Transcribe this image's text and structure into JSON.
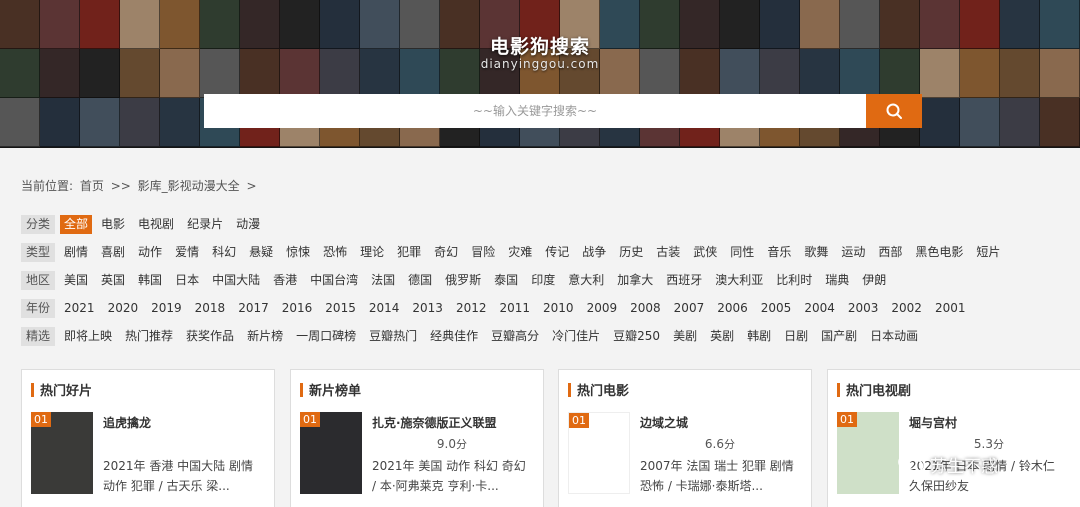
{
  "header": {
    "title": "电影狗搜索",
    "domain": "dianyinggou.com",
    "search_placeholder": "~~输入关键字搜索~~"
  },
  "breadcrumb": {
    "label": "当前位置:",
    "home": "首页",
    "sep": ">>",
    "current": "影库_影视动漫大全",
    "trail": ">"
  },
  "filters": [
    {
      "label": "分类",
      "items": [
        "全部",
        "电影",
        "电视剧",
        "纪录片",
        "动漫"
      ],
      "active": 0
    },
    {
      "label": "类型",
      "items": [
        "剧情",
        "喜剧",
        "动作",
        "爱情",
        "科幻",
        "悬疑",
        "惊悚",
        "恐怖",
        "理论",
        "犯罪",
        "奇幻",
        "冒险",
        "灾难",
        "传记",
        "战争",
        "历史",
        "古装",
        "武侠",
        "同性",
        "音乐",
        "歌舞",
        "运动",
        "西部",
        "黑色电影",
        "短片"
      ],
      "active": -1
    },
    {
      "label": "地区",
      "items": [
        "美国",
        "英国",
        "韩国",
        "日本",
        "中国大陆",
        "香港",
        "中国台湾",
        "法国",
        "德国",
        "俄罗斯",
        "泰国",
        "印度",
        "意大利",
        "加拿大",
        "西班牙",
        "澳大利亚",
        "比利时",
        "瑞典",
        "伊朗"
      ],
      "active": -1
    },
    {
      "label": "年份",
      "items": [
        "2021",
        "2020",
        "2019",
        "2018",
        "2017",
        "2016",
        "2015",
        "2014",
        "2013",
        "2012",
        "2011",
        "2010",
        "2009",
        "2008",
        "2007",
        "2006",
        "2005",
        "2004",
        "2003",
        "2002",
        "2001"
      ],
      "active": -1
    },
    {
      "label": "精选",
      "items": [
        "即将上映",
        "热门推荐",
        "获奖作品",
        "新片榜",
        "一周口碑榜",
        "豆瓣热门",
        "经典佳作",
        "豆瓣高分",
        "冷门佳片",
        "豆瓣250",
        "美剧",
        "英剧",
        "韩剧",
        "日剧",
        "国产剧",
        "日本动画"
      ],
      "active": -1
    }
  ],
  "cards": [
    {
      "heading": "热门好片",
      "rank": "01",
      "title": "追虎擒龙",
      "score": "",
      "unit": "",
      "meta": "2021年 香港 中国大陆 剧情 动作 犯罪 / 古天乐 梁...",
      "thumb_color": "#3a3a38"
    },
    {
      "heading": "新片榜单",
      "rank": "01",
      "title": "扎克·施奈德版正义联盟",
      "score": "9.0",
      "unit": "分",
      "meta": "2021年 美国 动作 科幻 奇幻 / 本·阿弗莱克 亨利·卡...",
      "thumb_color": "#2b2b2e"
    },
    {
      "heading": "热门电影",
      "rank": "01",
      "title": "边域之城",
      "score": "6.6",
      "unit": "分",
      "meta": "2007年 法国 瑞士 犯罪 剧情 恐怖 / 卡瑞娜·泰斯塔...",
      "thumb_color": ""
    },
    {
      "heading": "热门电视剧",
      "rank": "01",
      "title": "堀与宫村",
      "score": "5.3",
      "unit": "分",
      "meta": "2021年 日本 剧情 / 铃木仁 久保田纱友",
      "thumb_color": "#cfe0c8"
    }
  ],
  "watermark": "苏生不惑",
  "colors": {
    "accent": "#e06a12",
    "bg": "#f3f3f3"
  }
}
